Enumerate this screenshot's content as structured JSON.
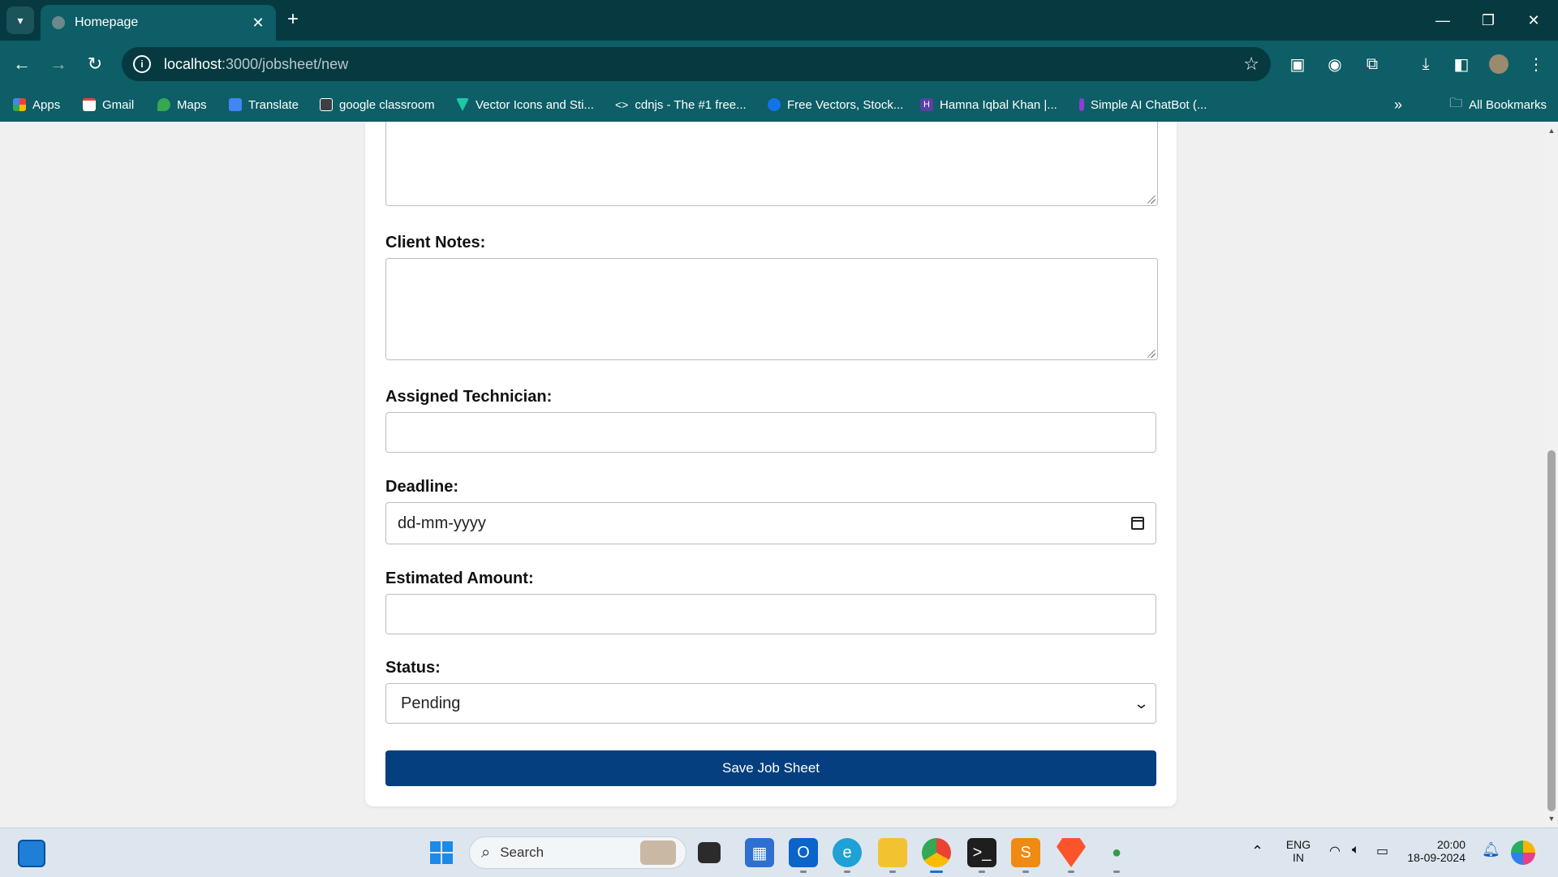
{
  "browser": {
    "tab_title": "Homepage",
    "url_host": "localhost",
    "url_path": ":3000/jobsheet/new",
    "colors": {
      "chrome_dark": "#063a40",
      "chrome": "#0d5e66"
    }
  },
  "bookmarks": [
    {
      "label": "Apps",
      "icon": "apps-grid-icon"
    },
    {
      "label": "Gmail",
      "icon": "gmail-icon"
    },
    {
      "label": "Maps",
      "icon": "maps-icon"
    },
    {
      "label": "Translate",
      "icon": "translate-icon"
    },
    {
      "label": "google classroom",
      "icon": "classroom-icon"
    },
    {
      "label": "Vector Icons and Sti...",
      "icon": "vector-icon"
    },
    {
      "label": "cdnjs - The #1 free...",
      "icon": "code-icon"
    },
    {
      "label": "Free Vectors, Stock...",
      "icon": "freepik-icon"
    },
    {
      "label": "Hamna Iqbal Khan |...",
      "icon": "h-icon"
    },
    {
      "label": "Simple AI ChatBot (...",
      "icon": "chatbot-icon"
    }
  ],
  "all_bookmarks_label": "All Bookmarks",
  "form": {
    "client_notes_label": "Client Notes:",
    "assigned_technician_label": "Assigned Technician:",
    "deadline_label": "Deadline:",
    "deadline_placeholder": "dd-mm-yyyy",
    "estimated_amount_label": "Estimated Amount:",
    "status_label": "Status:",
    "status_value": "Pending",
    "save_button_label": "Save Job Sheet",
    "button_color": "#063f7f"
  },
  "taskbar": {
    "search_label": "Search",
    "lang_top": "ENG",
    "lang_bottom": "IN",
    "time": "20:00",
    "date": "18-09-2024"
  }
}
